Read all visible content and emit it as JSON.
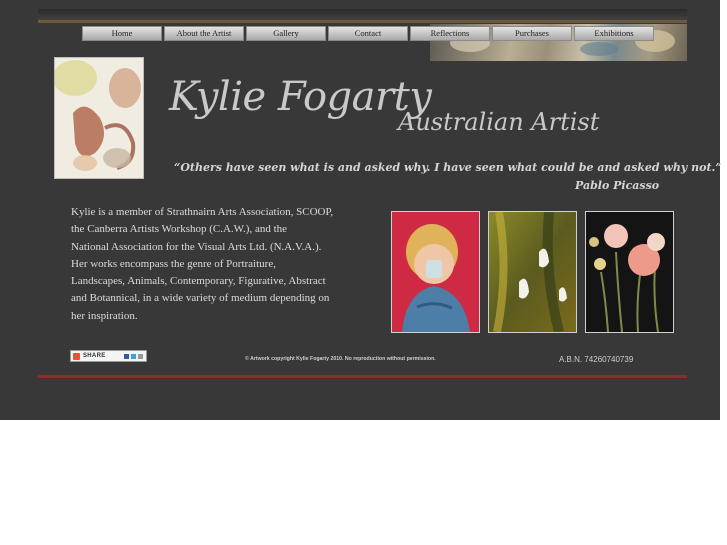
{
  "nav": {
    "items": [
      "Home",
      "About the Artist",
      "Gallery",
      "Contact",
      "Reflections",
      "Purchases",
      "Exhibitions"
    ]
  },
  "header": {
    "title": "Kylie Fogarty",
    "subtitle": "Australian Artist"
  },
  "quote": {
    "text": "“Others have seen what is and asked why.  I have seen what could be and asked why not.”",
    "author": "Pablo Picasso"
  },
  "bio": {
    "lines": [
      "Kylie is a member of Strathnairn Arts Association, SCOOP,",
      "the Canberra Artists Workshop (C.A.W.),  and the",
      "National Association for the Visual Arts Ltd. (N.A.V.A.).",
      "Her works encompass the genre of Portraiture,",
      "Landscapes, Animals, Contemporary, Figurative, Abstract",
      "and Botannical, in a wide variety of medium depending on",
      "her inspiration."
    ]
  },
  "share": {
    "label": "SHARE"
  },
  "footer": {
    "copyright": "© Artwork copyright Kylie Fogarty 2010. No reproduction without permission.",
    "abn": "A.B.N.  74260740739"
  },
  "colors": {
    "page_background": "#383838",
    "accent_rule": "#8e2b2b",
    "text_light": "#c9c9c9"
  },
  "icons": [
    "share-icon",
    "portrait-painting-image",
    "child-portrait-painting-image",
    "abstract-green-painting-image",
    "poppies-painting-image"
  ]
}
